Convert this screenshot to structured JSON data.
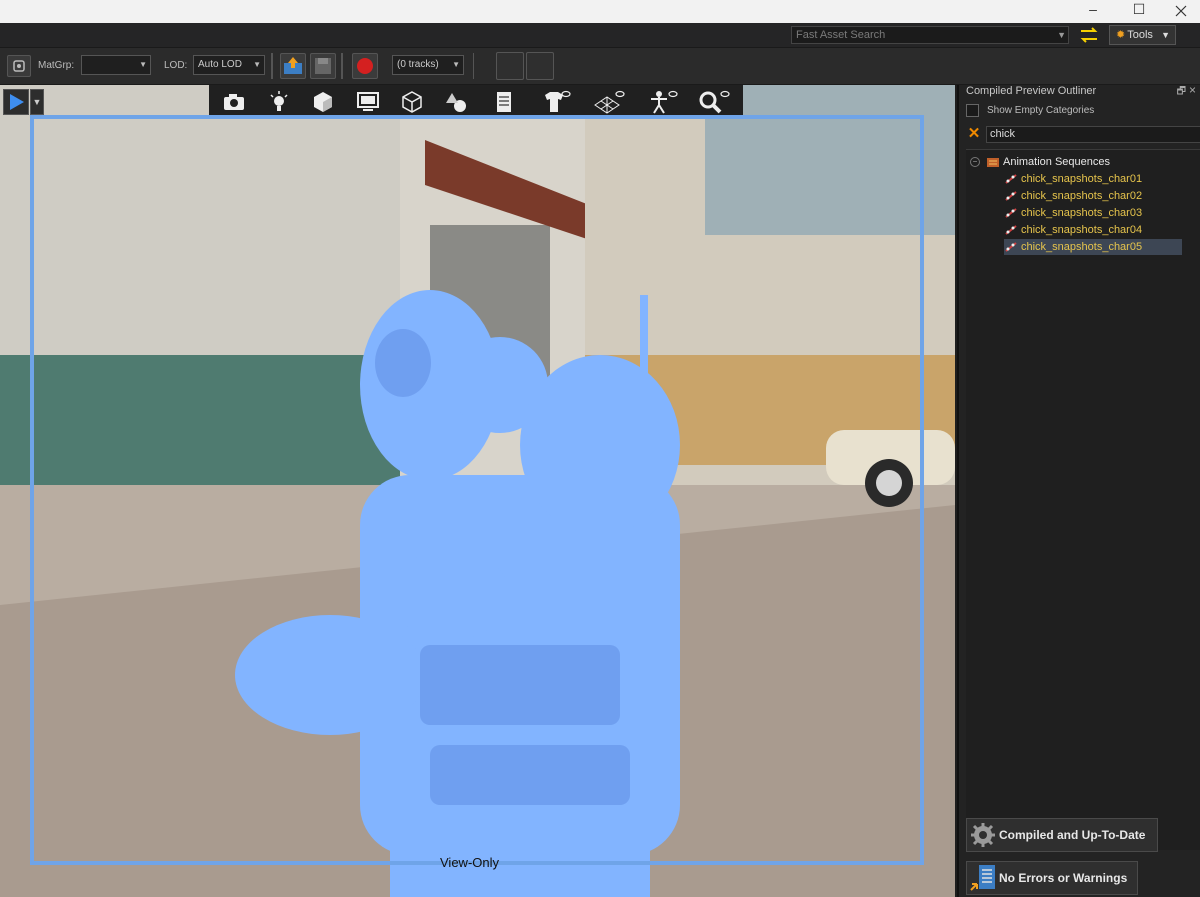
{
  "window": {
    "minimize": "–",
    "maximize": "☐"
  },
  "topbar": {
    "search_placeholder": "Fast Asset Search",
    "tools_label": "Tools"
  },
  "toolbar": {
    "matgrp_label": "MatGrp:",
    "matgrp_value": "",
    "lod_label": "LOD:",
    "lod_value": "Auto LOD",
    "tracks_value": "(0 tracks)"
  },
  "viewport": {
    "status_text": "View-Only",
    "tool_icons": [
      "camera-icon",
      "light-icon",
      "cube-icon",
      "monitor-icon",
      "wireframe-cube-icon",
      "shapes-icon",
      "document-icon",
      "shirt-visibility-icon",
      "grid-visibility-icon",
      "skeleton-visibility-icon",
      "zoom-visibility-icon"
    ],
    "frame_color": "#6fa4e8",
    "character_color": "#82b4ff"
  },
  "outliner": {
    "title": "Compiled Preview Outliner",
    "show_empty_label": "Show Empty Categories",
    "show_empty_checked": false,
    "search_value": "chick",
    "category": "Animation Sequences",
    "items": [
      {
        "label": "chick_snapshots_char01",
        "selected": false
      },
      {
        "label": "chick_snapshots_char02",
        "selected": false
      },
      {
        "label": "chick_snapshots_char03",
        "selected": false
      },
      {
        "label": "chick_snapshots_char04",
        "selected": false
      },
      {
        "label": "chick_snapshots_char05",
        "selected": true
      }
    ],
    "item_color": "#e6c44c"
  },
  "status": {
    "compiled": "Compiled and Up-To-Date",
    "errors": "No Errors or Warnings"
  }
}
